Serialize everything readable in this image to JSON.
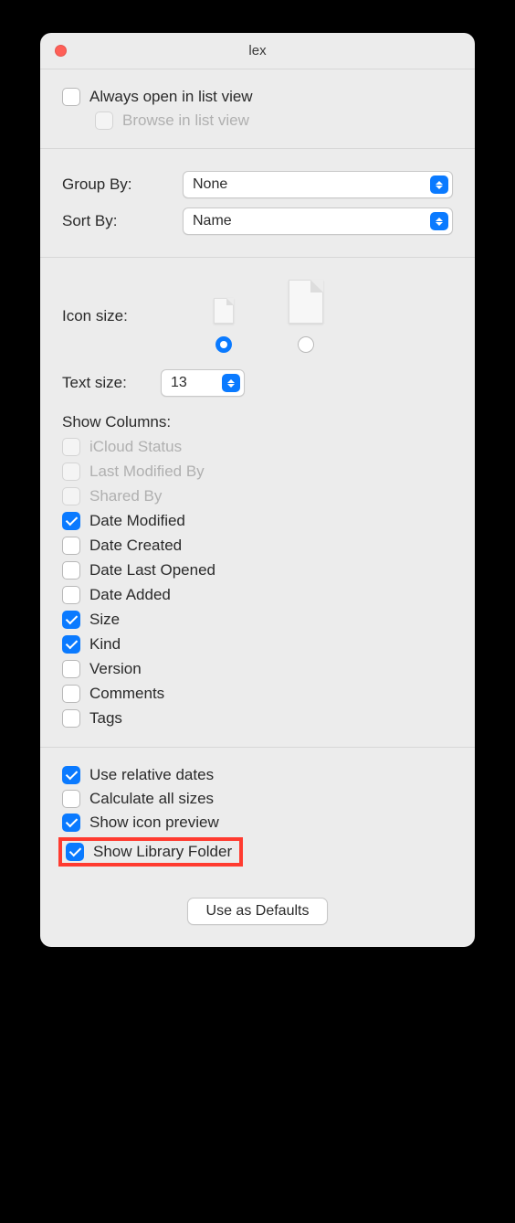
{
  "title": "lex",
  "top": {
    "always_open": "Always open in list view",
    "browse": "Browse in list view"
  },
  "group_by": {
    "label": "Group By:",
    "value": "None"
  },
  "sort_by": {
    "label": "Sort By:",
    "value": "Name"
  },
  "icon_size_label": "Icon size:",
  "text_size": {
    "label": "Text size:",
    "value": "13"
  },
  "show_columns_label": "Show Columns:",
  "columns": {
    "icloud": "iCloud Status",
    "last_modified_by": "Last Modified By",
    "shared_by": "Shared By",
    "date_modified": "Date Modified",
    "date_created": "Date Created",
    "date_last_opened": "Date Last Opened",
    "date_added": "Date Added",
    "size": "Size",
    "kind": "Kind",
    "version": "Version",
    "comments": "Comments",
    "tags": "Tags"
  },
  "options": {
    "relative_dates": "Use relative dates",
    "calc_sizes": "Calculate all sizes",
    "icon_preview": "Show icon preview",
    "library_folder": "Show Library Folder"
  },
  "defaults_button": "Use as Defaults"
}
